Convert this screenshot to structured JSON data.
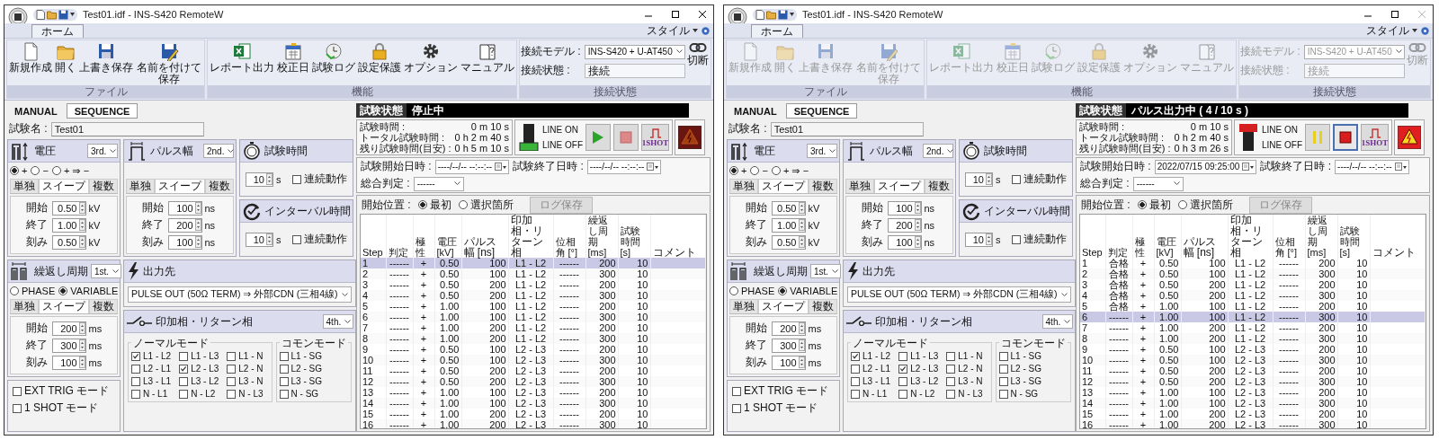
{
  "windows": [
    {
      "title": "Test01.idf - INS-S420 RemoteW",
      "close_disabled": false,
      "ribbon_tabs": [
        {
          "label": "ホーム",
          "selected": true
        }
      ],
      "style_menu": "スタイル",
      "ribbon": {
        "disabled": false,
        "groups": [
          {
            "kind": "buttons",
            "label": "ファイル",
            "buttons": [
              "新規作成",
              "開く",
              "上書き保存",
              "名前を付けて保存"
            ]
          },
          {
            "kind": "buttons",
            "label": "機能",
            "buttons": [
              "レポート出力",
              "校正日",
              "試験ログ",
              "設定保護",
              "オプション",
              "マニュアル"
            ]
          },
          {
            "kind": "connection",
            "label": "接続状態",
            "model_label": "接続モデル :",
            "model": "INS-S420 + U-AT450",
            "state_label": "接続状態 :",
            "state": "接続",
            "disconnect": "切断"
          }
        ]
      },
      "mode_tabs": [
        {
          "label": "MANUAL",
          "selected": false
        },
        {
          "label": "SEQUENCE",
          "selected": true
        }
      ],
      "test_name": {
        "label": "試験名 :",
        "value": "Test01"
      },
      "voltage": {
        "title": "電圧",
        "order": "3rd.",
        "polarity": [
          {
            "label": "+",
            "selected": true
          },
          {
            "label": "−",
            "selected": false
          },
          {
            "label": "+ ⇒ −",
            "selected": false
          }
        ],
        "tabs": [
          {
            "label": "単独",
            "selected": false
          },
          {
            "label": "スイープ",
            "selected": true
          },
          {
            "label": "複数",
            "selected": false
          }
        ],
        "fields": [
          {
            "label": "開始",
            "value": "0.50",
            "unit": "kV"
          },
          {
            "label": "終了",
            "value": "1.00",
            "unit": "kV"
          },
          {
            "label": "刻み",
            "value": "0.50",
            "unit": "kV"
          }
        ]
      },
      "pulse_width": {
        "title": "パルス幅",
        "order": "2nd.",
        "tabs": [
          {
            "label": "単独",
            "selected": false
          },
          {
            "label": "スイープ",
            "selected": true
          },
          {
            "label": "複数",
            "selected": false
          }
        ],
        "fields": [
          {
            "label": "開始",
            "value": "100",
            "unit": "ns"
          },
          {
            "label": "終了",
            "value": "200",
            "unit": "ns"
          },
          {
            "label": "刻み",
            "value": "100",
            "unit": "ns"
          }
        ]
      },
      "test_time": {
        "title": "試験時間",
        "value": "10",
        "unit": "s",
        "continuous": {
          "label": "連続動作",
          "checked": false
        }
      },
      "interval": {
        "title": "インターバル時間",
        "value": "10",
        "unit": "s",
        "continuous": {
          "label": "連続動作",
          "checked": false
        }
      },
      "repeat": {
        "title": "繰返し周期",
        "order": "1st.",
        "modes": [
          {
            "label": "PHASE",
            "selected": false
          },
          {
            "label": "VARIABLE",
            "selected": true
          }
        ],
        "tabs": [
          {
            "label": "単独",
            "selected": false
          },
          {
            "label": "スイープ",
            "selected": true
          },
          {
            "label": "複数",
            "selected": false
          }
        ],
        "fields": [
          {
            "label": "開始",
            "value": "200",
            "unit": "ms"
          },
          {
            "label": "終了",
            "value": "300",
            "unit": "ms"
          },
          {
            "label": "刻み",
            "value": "100",
            "unit": "ms"
          }
        ]
      },
      "mode_options": [
        {
          "label": "EXT TRIG モード",
          "checked": false
        },
        {
          "label": "1 SHOT モード",
          "checked": false
        }
      ],
      "output": {
        "title": "出力先",
        "value": "PULSE OUT (50Ω TERM) ⇒ 外部CDN (三相4線)"
      },
      "phases": {
        "title": "印加相・リターン相",
        "order": "4th.",
        "normal": {
          "label": "ノーマルモード",
          "items": [
            {
              "label": "L1 - L2",
              "checked": true
            },
            {
              "label": "L1 - L3",
              "checked": false
            },
            {
              "label": "L1 - N",
              "checked": false
            },
            {
              "label": "L2 - L1",
              "checked": false
            },
            {
              "label": "L2 - L3",
              "checked": true
            },
            {
              "label": "L2 - N",
              "checked": false
            },
            {
              "label": "L3 - L1",
              "checked": false
            },
            {
              "label": "L3 - L2",
              "checked": false
            },
            {
              "label": "L3 - N",
              "checked": false
            },
            {
              "label": "N - L1",
              "checked": false
            },
            {
              "label": "N - L2",
              "checked": false
            },
            {
              "label": "N - L3",
              "checked": false
            }
          ]
        },
        "common": {
          "label": "コモンモード",
          "items": [
            {
              "label": "L1 - SG",
              "checked": false
            },
            {
              "label": "L2 - SG",
              "checked": false
            },
            {
              "label": "L3 - SG",
              "checked": false
            },
            {
              "label": "N - SG",
              "checked": false
            }
          ]
        }
      },
      "status": {
        "label": "試験状態",
        "value": "停止中"
      },
      "times": [
        {
          "label": "試験時間 :",
          "value": "0 m 10 s"
        },
        {
          "label": "トータル試験時間 :",
          "value": "0 h 2 m 40 s"
        },
        {
          "label": "残り試験時間(目安) :",
          "value": "0 h 5 m 10 s"
        }
      ],
      "line": {
        "on_label": "LINE ON",
        "off_label": "LINE OFF",
        "on": false
      },
      "run_button": {
        "kind": "start"
      },
      "stop_button": {
        "active": false
      },
      "oneshot_button": {
        "label": "1SHOT"
      },
      "hazard": {
        "lit": false
      },
      "dates": [
        {
          "label": "試験開始日時 :",
          "value": "----/--/-- --:--:--"
        },
        {
          "label": "試験終了日時 :",
          "value": "----/--/-- --:--:--"
        }
      ],
      "overall": {
        "label": "総合判定 :",
        "value": "------"
      },
      "start_position": {
        "label": "開始位置 :",
        "options": [
          {
            "label": "最初",
            "selected": true
          },
          {
            "label": "選択箇所",
            "selected": false
          }
        ]
      },
      "log_button": {
        "label": "ログ保存",
        "disabled": true
      },
      "table": {
        "columns": [
          "Step",
          "判定",
          "極性",
          "電圧 [kV]",
          "パルス幅 [ns]",
          "印加相・リターン相",
          "位相角 [°]",
          "繰返し周期 [ms]",
          "試験時間 [s]",
          "コメント"
        ],
        "rows": [
          {
            "cells": [
              "1",
              "------",
              "+",
              "0.50",
              "100",
              "L1 - L2",
              "------",
              "200",
              "10"
            ],
            "selected": true
          },
          {
            "cells": [
              "2",
              "------",
              "+",
              "0.50",
              "100",
              "L1 - L2",
              "------",
              "300",
              "10"
            ],
            "selected": false
          },
          {
            "cells": [
              "3",
              "------",
              "+",
              "0.50",
              "200",
              "L1 - L2",
              "------",
              "200",
              "10"
            ],
            "selected": false
          },
          {
            "cells": [
              "4",
              "------",
              "+",
              "0.50",
              "200",
              "L1 - L2",
              "------",
              "300",
              "10"
            ],
            "selected": false
          },
          {
            "cells": [
              "5",
              "------",
              "+",
              "1.00",
              "100",
              "L1 - L2",
              "------",
              "200",
              "10"
            ],
            "selected": false
          },
          {
            "cells": [
              "6",
              "------",
              "+",
              "1.00",
              "100",
              "L1 - L2",
              "------",
              "300",
              "10"
            ],
            "selected": false
          },
          {
            "cells": [
              "7",
              "------",
              "+",
              "1.00",
              "200",
              "L1 - L2",
              "------",
              "200",
              "10"
            ],
            "selected": false
          },
          {
            "cells": [
              "8",
              "------",
              "+",
              "1.00",
              "200",
              "L1 - L2",
              "------",
              "300",
              "10"
            ],
            "selected": false
          },
          {
            "cells": [
              "9",
              "------",
              "+",
              "0.50",
              "100",
              "L2 - L3",
              "------",
              "200",
              "10"
            ],
            "selected": false
          },
          {
            "cells": [
              "10",
              "------",
              "+",
              "0.50",
              "100",
              "L2 - L3",
              "------",
              "300",
              "10"
            ],
            "selected": false
          },
          {
            "cells": [
              "11",
              "------",
              "+",
              "0.50",
              "200",
              "L2 - L3",
              "------",
              "200",
              "10"
            ],
            "selected": false
          },
          {
            "cells": [
              "12",
              "------",
              "+",
              "0.50",
              "200",
              "L2 - L3",
              "------",
              "300",
              "10"
            ],
            "selected": false
          },
          {
            "cells": [
              "13",
              "------",
              "+",
              "1.00",
              "100",
              "L2 - L3",
              "------",
              "200",
              "10"
            ],
            "selected": false
          },
          {
            "cells": [
              "14",
              "------",
              "+",
              "1.00",
              "100",
              "L2 - L3",
              "------",
              "300",
              "10"
            ],
            "selected": false
          },
          {
            "cells": [
              "15",
              "------",
              "+",
              "1.00",
              "200",
              "L2 - L3",
              "------",
              "200",
              "10"
            ],
            "selected": false
          },
          {
            "cells": [
              "16",
              "------",
              "+",
              "1.00",
              "200",
              "L2 - L3",
              "------",
              "300",
              "10"
            ],
            "selected": false
          }
        ]
      }
    },
    {
      "title": "Test01.idf - INS-S420 RemoteW",
      "close_disabled": true,
      "ribbon_tabs": [
        {
          "label": "ホーム",
          "selected": true
        }
      ],
      "style_menu": "スタイル",
      "ribbon": {
        "disabled": true,
        "groups": [
          {
            "kind": "buttons",
            "label": "ファイル",
            "buttons": [
              "新規作成",
              "開く",
              "上書き保存",
              "名前を付けて保存"
            ]
          },
          {
            "kind": "buttons",
            "label": "機能",
            "buttons": [
              "レポート出力",
              "校正日",
              "試験ログ",
              "設定保護",
              "オプション",
              "マニュアル"
            ]
          },
          {
            "kind": "connection",
            "label": "接続状態",
            "model_label": "接続モデル :",
            "model": "INS-S420 + U-AT450",
            "state_label": "接続状態 :",
            "state": "接続",
            "disconnect": "切断"
          }
        ]
      },
      "mode_tabs": [
        {
          "label": "MANUAL",
          "selected": false
        },
        {
          "label": "SEQUENCE",
          "selected": true
        }
      ],
      "test_name": {
        "label": "試験名 :",
        "value": "Test01"
      },
      "voltage": {
        "title": "電圧",
        "order": "3rd.",
        "polarity": [
          {
            "label": "+",
            "selected": true
          },
          {
            "label": "−",
            "selected": false
          },
          {
            "label": "+ ⇒ −",
            "selected": false
          }
        ],
        "tabs": [
          {
            "label": "単独",
            "selected": false
          },
          {
            "label": "スイープ",
            "selected": true
          },
          {
            "label": "複数",
            "selected": false
          }
        ],
        "fields": [
          {
            "label": "開始",
            "value": "0.50",
            "unit": "kV"
          },
          {
            "label": "終了",
            "value": "1.00",
            "unit": "kV"
          },
          {
            "label": "刻み",
            "value": "0.50",
            "unit": "kV"
          }
        ]
      },
      "pulse_width": {
        "title": "パルス幅",
        "order": "2nd.",
        "tabs": [
          {
            "label": "単独",
            "selected": false
          },
          {
            "label": "スイープ",
            "selected": true
          },
          {
            "label": "複数",
            "selected": false
          }
        ],
        "fields": [
          {
            "label": "開始",
            "value": "100",
            "unit": "ns"
          },
          {
            "label": "終了",
            "value": "200",
            "unit": "ns"
          },
          {
            "label": "刻み",
            "value": "100",
            "unit": "ns"
          }
        ]
      },
      "test_time": {
        "title": "試験時間",
        "value": "10",
        "unit": "s",
        "continuous": {
          "label": "連続動作",
          "checked": false
        }
      },
      "interval": {
        "title": "インターバル時間",
        "value": "10",
        "unit": "s",
        "continuous": {
          "label": "連続動作",
          "checked": false
        }
      },
      "repeat": {
        "title": "繰返し周期",
        "order": "1st.",
        "modes": [
          {
            "label": "PHASE",
            "selected": false
          },
          {
            "label": "VARIABLE",
            "selected": true
          }
        ],
        "tabs": [
          {
            "label": "単独",
            "selected": false
          },
          {
            "label": "スイープ",
            "selected": true
          },
          {
            "label": "複数",
            "selected": false
          }
        ],
        "fields": [
          {
            "label": "開始",
            "value": "200",
            "unit": "ms"
          },
          {
            "label": "終了",
            "value": "300",
            "unit": "ms"
          },
          {
            "label": "刻み",
            "value": "100",
            "unit": "ms"
          }
        ]
      },
      "mode_options": [
        {
          "label": "EXT TRIG モード",
          "checked": false
        },
        {
          "label": "1 SHOT モード",
          "checked": false
        }
      ],
      "output": {
        "title": "出力先",
        "value": "PULSE OUT (50Ω TERM) ⇒ 外部CDN (三相4線)"
      },
      "phases": {
        "title": "印加相・リターン相",
        "order": "4th.",
        "normal": {
          "label": "ノーマルモード",
          "items": [
            {
              "label": "L1 - L2",
              "checked": true
            },
            {
              "label": "L1 - L3",
              "checked": false
            },
            {
              "label": "L1 - N",
              "checked": false
            },
            {
              "label": "L2 - L1",
              "checked": false
            },
            {
              "label": "L2 - L3",
              "checked": true
            },
            {
              "label": "L2 - N",
              "checked": false
            },
            {
              "label": "L3 - L1",
              "checked": false
            },
            {
              "label": "L3 - L2",
              "checked": false
            },
            {
              "label": "L3 - N",
              "checked": false
            },
            {
              "label": "N - L1",
              "checked": false
            },
            {
              "label": "N - L2",
              "checked": false
            },
            {
              "label": "N - L3",
              "checked": false
            }
          ]
        },
        "common": {
          "label": "コモンモード",
          "items": [
            {
              "label": "L1 - SG",
              "checked": false
            },
            {
              "label": "L2 - SG",
              "checked": false
            },
            {
              "label": "L3 - SG",
              "checked": false
            },
            {
              "label": "N - SG",
              "checked": false
            }
          ]
        }
      },
      "status": {
        "label": "試験状態",
        "value": "パルス出力中 ( 4 / 10 s )"
      },
      "times": [
        {
          "label": "試験時間 :",
          "value": "0 m 10 s"
        },
        {
          "label": "トータル試験時間 :",
          "value": "0 h 2 m 40 s"
        },
        {
          "label": "残り試験時間(目安) :",
          "value": "0 h 3 m 26 s"
        }
      ],
      "line": {
        "on_label": "LINE ON",
        "off_label": "LINE OFF",
        "on": true
      },
      "run_button": {
        "kind": "pause"
      },
      "stop_button": {
        "active": true
      },
      "oneshot_button": {
        "label": "1SHOT"
      },
      "hazard": {
        "lit": true
      },
      "dates": [
        {
          "label": "試験開始日時 :",
          "value": "2022/07/15 09:25:00"
        },
        {
          "label": "試験終了日時 :",
          "value": "----/--/-- --:--:--"
        }
      ],
      "overall": {
        "label": "総合判定 :",
        "value": "------"
      },
      "start_position": {
        "label": "開始位置 :",
        "options": [
          {
            "label": "最初",
            "selected": true
          },
          {
            "label": "選択箇所",
            "selected": false
          }
        ]
      },
      "log_button": {
        "label": "ログ保存",
        "disabled": true
      },
      "table": {
        "columns": [
          "Step",
          "判定",
          "極性",
          "電圧 [kV]",
          "パルス幅 [ns]",
          "印加相・リターン相",
          "位相角 [°]",
          "繰返し周期 [ms]",
          "試験時間 [s]",
          "コメント"
        ],
        "rows": [
          {
            "cells": [
              "1",
              "合格",
              "+",
              "0.50",
              "100",
              "L1 - L2",
              "------",
              "200",
              "10"
            ],
            "selected": false
          },
          {
            "cells": [
              "2",
              "合格",
              "+",
              "0.50",
              "100",
              "L1 - L2",
              "------",
              "300",
              "10"
            ],
            "selected": false
          },
          {
            "cells": [
              "3",
              "合格",
              "+",
              "0.50",
              "200",
              "L1 - L2",
              "------",
              "200",
              "10"
            ],
            "selected": false
          },
          {
            "cells": [
              "4",
              "合格",
              "+",
              "0.50",
              "200",
              "L1 - L2",
              "------",
              "300",
              "10"
            ],
            "selected": false
          },
          {
            "cells": [
              "5",
              "合格",
              "+",
              "1.00",
              "100",
              "L1 - L2",
              "------",
              "200",
              "10"
            ],
            "selected": false
          },
          {
            "cells": [
              "6",
              "------",
              "+",
              "1.00",
              "100",
              "L1 - L2",
              "------",
              "300",
              "10"
            ],
            "selected": true
          },
          {
            "cells": [
              "7",
              "------",
              "+",
              "1.00",
              "200",
              "L1 - L2",
              "------",
              "200",
              "10"
            ],
            "selected": false
          },
          {
            "cells": [
              "8",
              "------",
              "+",
              "1.00",
              "200",
              "L1 - L2",
              "------",
              "300",
              "10"
            ],
            "selected": false
          },
          {
            "cells": [
              "9",
              "------",
              "+",
              "0.50",
              "100",
              "L2 - L3",
              "------",
              "200",
              "10"
            ],
            "selected": false
          },
          {
            "cells": [
              "10",
              "------",
              "+",
              "0.50",
              "100",
              "L2 - L3",
              "------",
              "300",
              "10"
            ],
            "selected": false
          },
          {
            "cells": [
              "11",
              "------",
              "+",
              "0.50",
              "200",
              "L2 - L3",
              "------",
              "200",
              "10"
            ],
            "selected": false
          },
          {
            "cells": [
              "12",
              "------",
              "+",
              "0.50",
              "200",
              "L2 - L3",
              "------",
              "300",
              "10"
            ],
            "selected": false
          },
          {
            "cells": [
              "13",
              "------",
              "+",
              "1.00",
              "100",
              "L2 - L3",
              "------",
              "200",
              "10"
            ],
            "selected": false
          },
          {
            "cells": [
              "14",
              "------",
              "+",
              "1.00",
              "100",
              "L2 - L3",
              "------",
              "300",
              "10"
            ],
            "selected": false
          },
          {
            "cells": [
              "15",
              "------",
              "+",
              "1.00",
              "200",
              "L2 - L3",
              "------",
              "200",
              "10"
            ],
            "selected": false
          },
          {
            "cells": [
              "16",
              "------",
              "+",
              "1.00",
              "200",
              "L2 - L3",
              "------",
              "300",
              "10"
            ],
            "selected": false
          }
        ]
      }
    }
  ]
}
